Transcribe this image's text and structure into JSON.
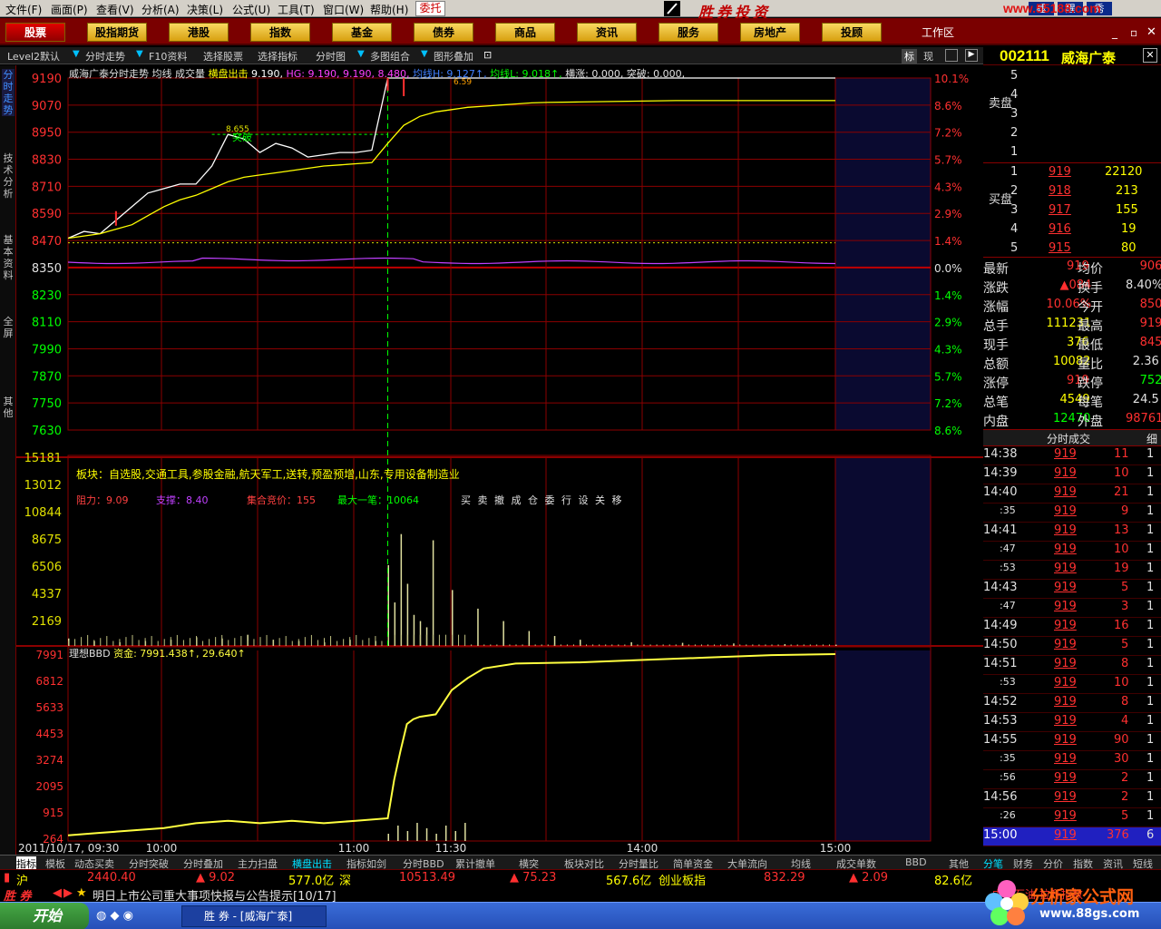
{
  "menu": [
    "文件(F)",
    "画面(P)",
    "查看(V)",
    "分析(A)",
    "决策(L)",
    "公式(U)",
    "工具(T)",
    "窗口(W)",
    "帮助(H)"
  ],
  "weituo": "委托",
  "brand": "胜券投资",
  "url_brand": "www.55188.com",
  "top_right_btns": [
    "睡",
    "醒",
    "秀"
  ],
  "toolbar": [
    "股票",
    "股指期货",
    "港股",
    "指数",
    "基金",
    "债券",
    "商品",
    "资讯",
    "服务",
    "房地产",
    "投顾"
  ],
  "workarea": "工作区",
  "subbar": [
    "Level2默认",
    "分时走势",
    "F10资料",
    "选择股票",
    "选择指标",
    "分时图",
    "多图组合",
    "图形叠加"
  ],
  "subbar_right": [
    "标",
    "现"
  ],
  "stock": {
    "code": "002111",
    "name": "威海广泰"
  },
  "left_tabs": [
    "分时走势",
    "技术分析",
    "基本资料",
    "全屏",
    "其他"
  ],
  "chart_header": {
    "title": "威海广泰分时走势",
    "items": [
      "均线",
      "成交量",
      "横盘出击",
      "9.190,"
    ],
    "hg": "HG: 9.190, 9.190, 8.480,",
    "jxh": "均线H: 9.127↑,",
    "jxl": "均线L: 9.018↑,",
    "hz": "横涨: 0.000,",
    "tp": "突破: 0.000,"
  },
  "price_axis": [
    "9190",
    "9070",
    "8950",
    "8830",
    "8710",
    "8590",
    "8470",
    "8350",
    "8230",
    "8110",
    "7990",
    "7870",
    "7750",
    "7630"
  ],
  "pct_axis": [
    "10.1%",
    "8.6%",
    "7.2%",
    "5.7%",
    "4.3%",
    "2.9%",
    "1.4%",
    "0.0%",
    "1.4%",
    "2.9%",
    "4.3%",
    "5.7%",
    "7.2%",
    "8.6%"
  ],
  "vol_axis": [
    "15181",
    "13012",
    "10844",
    "8675",
    "6506",
    "4337",
    "2169"
  ],
  "bbd_axis": [
    "7991",
    "6812",
    "5633",
    "4453",
    "3274",
    "2095",
    "915",
    "264"
  ],
  "time_axis": [
    "2011/10/17, 09:30",
    "10:00",
    "11:00",
    "11:30",
    "14:00",
    "15:00"
  ],
  "chart_labels": {
    "tupo": "突破",
    "price_mark": "8.655",
    "top_tag": "6.59"
  },
  "sector": "板块：自选股,交通工具,参股金融,航天军工,送转,预盈预增,山东,专用设备制造业",
  "indicators": {
    "resist": "阻力：9.09",
    "support": "支撑：8.40",
    "auction": "集合竞价：155",
    "maxtrade": "最大一笔：10064",
    "actions": "买 卖 撤 成 仓 委 行 设 关 移"
  },
  "bbd_header": {
    "name": "理想BBD",
    "value": "资金: 7991.438↑, 29.640↑"
  },
  "sell_label": "卖盘",
  "buy_label": "买盘",
  "sell_levels": [
    {
      "lvl": "5",
      "price": "",
      "vol": ""
    },
    {
      "lvl": "4",
      "price": "",
      "vol": ""
    },
    {
      "lvl": "3",
      "price": "",
      "vol": ""
    },
    {
      "lvl": "2",
      "price": "",
      "vol": ""
    },
    {
      "lvl": "1",
      "price": "",
      "vol": ""
    }
  ],
  "buy_levels": [
    {
      "lvl": "1",
      "price": "919",
      "vol": "22120"
    },
    {
      "lvl": "2",
      "price": "918",
      "vol": "213"
    },
    {
      "lvl": "3",
      "price": "917",
      "vol": "155"
    },
    {
      "lvl": "4",
      "price": "916",
      "vol": "19"
    },
    {
      "lvl": "5",
      "price": "915",
      "vol": "80"
    }
  ],
  "quote": [
    {
      "l": "最新",
      "v": "919",
      "l2": "均价",
      "v2": "906"
    },
    {
      "l": "涨跌",
      "v": "▲084",
      "l2": "换手",
      "v2": "8.40%"
    },
    {
      "l": "涨幅",
      "v": "10.06%",
      "l2": "今开",
      "v2": "850"
    },
    {
      "l": "总手",
      "v": "111231",
      "l2": "最高",
      "v2": "919"
    },
    {
      "l": "现手",
      "v": "376",
      "l2": "最低",
      "v2": "845"
    },
    {
      "l": "总额",
      "v": "10082",
      "l2": "量比",
      "v2": "2.36"
    },
    {
      "l": "涨停",
      "v": "919",
      "l2": "跌停",
      "v2": "752"
    },
    {
      "l": "总笔",
      "v": "4549",
      "l2": "每笔",
      "v2": "24.5"
    },
    {
      "l": "内盘",
      "v": "12470",
      "l2": "外盘",
      "v2": "98761"
    }
  ],
  "trades_title": "分时成交",
  "trades_detail": "细",
  "trades": [
    {
      "t": "14:38",
      "p": "919",
      "v": "11",
      "n": "1"
    },
    {
      "t": "14:39",
      "p": "919",
      "v": "10",
      "n": "1"
    },
    {
      "t": "14:40",
      "p": "919",
      "v": "21",
      "n": "1"
    },
    {
      "t": ":35",
      "p": "919",
      "v": "9",
      "n": "1"
    },
    {
      "t": "14:41",
      "p": "919",
      "v": "13",
      "n": "1"
    },
    {
      "t": ":47",
      "p": "919",
      "v": "10",
      "n": "1"
    },
    {
      "t": ":53",
      "p": "919",
      "v": "19",
      "n": "1"
    },
    {
      "t": "14:43",
      "p": "919",
      "v": "5",
      "n": "1"
    },
    {
      "t": ":47",
      "p": "919",
      "v": "3",
      "n": "1"
    },
    {
      "t": "14:49",
      "p": "919",
      "v": "16",
      "n": "1"
    },
    {
      "t": "14:50",
      "p": "919",
      "v": "5",
      "n": "1"
    },
    {
      "t": "14:51",
      "p": "919",
      "v": "8",
      "n": "1"
    },
    {
      "t": ":53",
      "p": "919",
      "v": "10",
      "n": "1"
    },
    {
      "t": "14:52",
      "p": "919",
      "v": "8",
      "n": "1"
    },
    {
      "t": "14:53",
      "p": "919",
      "v": "4",
      "n": "1"
    },
    {
      "t": "14:55",
      "p": "919",
      "v": "90",
      "n": "1"
    },
    {
      "t": ":35",
      "p": "919",
      "v": "30",
      "n": "1"
    },
    {
      "t": ":56",
      "p": "919",
      "v": "2",
      "n": "1"
    },
    {
      "t": "14:56",
      "p": "919",
      "v": "2",
      "n": "1"
    },
    {
      "t": ":26",
      "p": "919",
      "v": "5",
      "n": "1"
    },
    {
      "t": "15:00",
      "p": "919",
      "v": "376",
      "n": "6"
    }
  ],
  "bottom_tabs": [
    "指标",
    "模板",
    "动态买卖",
    "分时突破",
    "分时叠加",
    "主力扫盘",
    "横盘出击",
    "指标如剑",
    "分时BBD",
    "累计撤单",
    "横突",
    "板块对比",
    "分时量比",
    "简单资金",
    "大单流向",
    "均线",
    "成交单数",
    "BBD",
    "其他"
  ],
  "bottom_tabs_right": [
    "分笔",
    "财务",
    "分价",
    "指数",
    "资讯",
    "短线"
  ],
  "ticker": {
    "sh_label": "沪",
    "sh_val": "2440.40",
    "sh_chg": "▲ 9.02",
    "sh_amt": "577.0亿",
    "sz_label": "深",
    "sz_val": "10513.49",
    "sz_chg": "▲ 75.23",
    "sz_amt": "567.6亿",
    "cy_label": "创业板指",
    "cy_val": "832.29",
    "cy_chg": "▲ 2.09",
    "cy_amt": "82.6亿"
  },
  "news": {
    "left": "胜 券",
    "text": "明日上市公司重大事项快报与公告提示[10/17]",
    "right": "中国石油 拉升指数"
  },
  "taskbar": {
    "start": "开始",
    "item": "胜 券 - [威海广泰]"
  },
  "watermark": {
    "title": "分析家公式网",
    "url": "www.88gs.com"
  },
  "colors": {
    "up": "#ff3030",
    "down": "#00ff00",
    "grid": "#8b0000",
    "price_line": "#ffffff",
    "avg_line": "#ffff00",
    "bbd_line": "#ffff40",
    "purple": "#c040ff"
  },
  "chart_data": [
    {
      "type": "line",
      "title": "威海广泰分时走势",
      "ylim": [
        7630,
        9190
      ],
      "x": [
        0,
        5,
        10,
        15,
        20,
        25,
        30,
        35,
        40,
        45,
        50,
        55,
        60,
        65,
        70,
        75,
        80,
        85,
        90,
        95,
        100,
        105,
        110,
        115,
        120,
        125,
        130,
        135,
        140,
        145,
        150,
        160,
        170,
        180,
        190,
        200,
        210,
        220,
        230,
        240
      ],
      "series": [
        {
          "name": "price",
          "values": [
            8480,
            8510,
            8500,
            8560,
            8620,
            8680,
            8700,
            8720,
            8720,
            8800,
            8940,
            8920,
            8860,
            8900,
            8880,
            8840,
            8850,
            8860,
            8860,
            8870,
            9190,
            9190,
            9190,
            9190,
            9190,
            9190,
            9190,
            9190,
            9190,
            9190,
            9190,
            9190,
            9190,
            9190,
            9190,
            9190,
            9190,
            9190,
            9190,
            9190
          ]
        },
        {
          "name": "avg",
          "values": [
            8480,
            8490,
            8500,
            8520,
            8540,
            8580,
            8620,
            8650,
            8670,
            8700,
            8730,
            8750,
            8760,
            8770,
            8780,
            8790,
            8800,
            8805,
            8810,
            8815,
            8900,
            8980,
            9020,
            9040,
            9050,
            9060,
            9065,
            9070,
            9075,
            9080,
            9082,
            9084,
            9086,
            9088,
            9090,
            9090,
            9090,
            9090,
            9090,
            9090
          ]
        }
      ]
    },
    {
      "type": "bar",
      "title": "成交量",
      "ylim": [
        0,
        15181
      ],
      "x": [
        0,
        8,
        16,
        24,
        32,
        40,
        48,
        56,
        64,
        72,
        80,
        88,
        96,
        100,
        102,
        104,
        106,
        108,
        110,
        112,
        114,
        120,
        128,
        136,
        144,
        152,
        160,
        176,
        192,
        208,
        224,
        240
      ],
      "values": [
        600,
        400,
        300,
        400,
        500,
        700,
        600,
        900,
        500,
        400,
        300,
        500,
        400,
        6500,
        3500,
        9000,
        5000,
        2500,
        2000,
        1500,
        8500,
        4500,
        3000,
        2000,
        1200,
        800,
        500,
        300,
        250,
        200,
        150,
        100
      ]
    },
    {
      "type": "line",
      "title": "理想BBD",
      "ylim": [
        264,
        7991
      ],
      "x": [
        0,
        10,
        20,
        30,
        40,
        50,
        60,
        70,
        80,
        90,
        100,
        102,
        104,
        106,
        108,
        110,
        115,
        120,
        125,
        130,
        140,
        160,
        180,
        200,
        220,
        240
      ],
      "values": [
        500,
        600,
        700,
        800,
        1000,
        1100,
        1000,
        1100,
        1000,
        1100,
        1200,
        2800,
        4000,
        5100,
        5300,
        5400,
        5500,
        6500,
        7000,
        7400,
        7600,
        7650,
        7750,
        7850,
        7950,
        7991
      ]
    }
  ]
}
